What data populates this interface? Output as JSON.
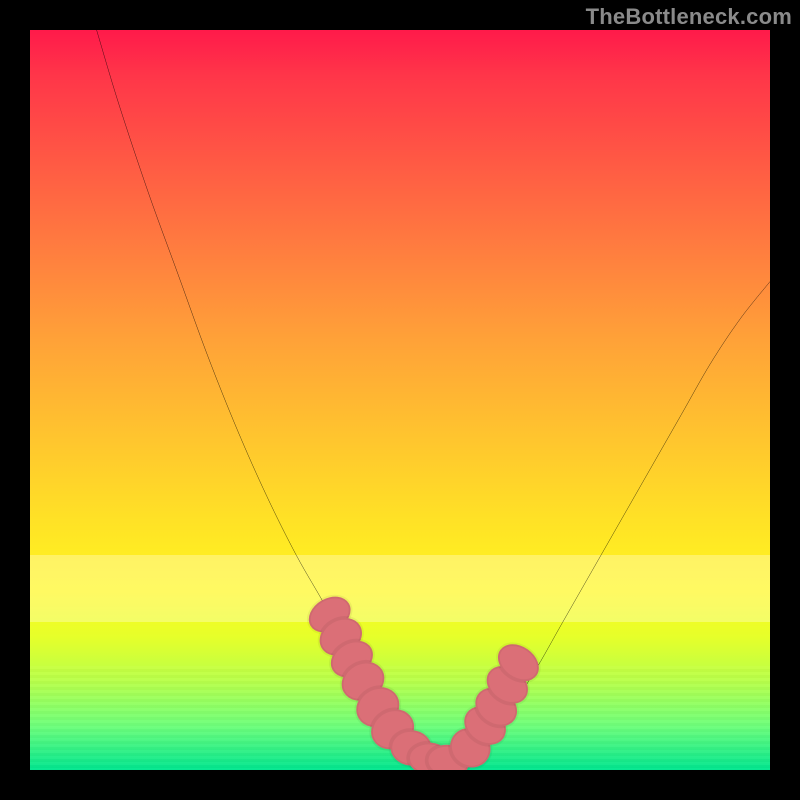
{
  "watermark": "TheBottleneck.com",
  "colors": {
    "frame": "#000000",
    "curve": "#000000",
    "marker": "#db6f77",
    "gradient_top": "#ff1a4a",
    "gradient_bottom": "#00e68f"
  },
  "chart_data": {
    "type": "line",
    "title": "",
    "xlabel": "",
    "ylabel": "",
    "xlim": [
      0,
      100
    ],
    "ylim": [
      0,
      100
    ],
    "note": "Axes are unlabeled in the source image. x/y values are estimated image-space percentages (0 at left/top edges of the plot area, 100 at right/bottom). The curve is a V-shaped bottleneck curve with markers clustered near the trough.",
    "series": [
      {
        "name": "curve",
        "x": [
          9,
          12,
          16,
          20,
          24,
          28,
          32,
          36,
          40,
          43,
          46,
          48,
          50,
          52,
          54,
          57,
          60,
          64,
          68,
          72,
          76,
          80,
          84,
          88,
          92,
          96,
          100
        ],
        "y": [
          0,
          10,
          22,
          33,
          44,
          54,
          63,
          71,
          78,
          84,
          89,
          93,
          96,
          98,
          99,
          99,
          97,
          93,
          87,
          80,
          73,
          66,
          59,
          52,
          45,
          39,
          34
        ]
      }
    ],
    "markers": {
      "name": "highlighted-points",
      "x": [
        40.5,
        42.0,
        43.5,
        45.0,
        47.0,
        49.0,
        51.5,
        54.0,
        56.5,
        59.5,
        61.5,
        63.0,
        64.5,
        66.0
      ],
      "y": [
        79.0,
        82.0,
        85.0,
        88.0,
        91.5,
        94.5,
        97.0,
        98.5,
        98.8,
        97.0,
        94.0,
        91.5,
        88.5,
        85.5
      ],
      "rx": [
        2.2,
        2.4,
        2.3,
        2.5,
        2.6,
        2.6,
        2.8,
        2.9,
        2.9,
        2.6,
        2.4,
        2.4,
        2.3,
        2.2
      ],
      "ry": [
        3.0,
        3.0,
        3.0,
        3.0,
        3.0,
        3.0,
        2.4,
        2.2,
        2.2,
        2.8,
        3.0,
        3.0,
        3.0,
        3.0
      ]
    },
    "pale_band": {
      "top_pct": 71,
      "height_pct": 9
    }
  }
}
